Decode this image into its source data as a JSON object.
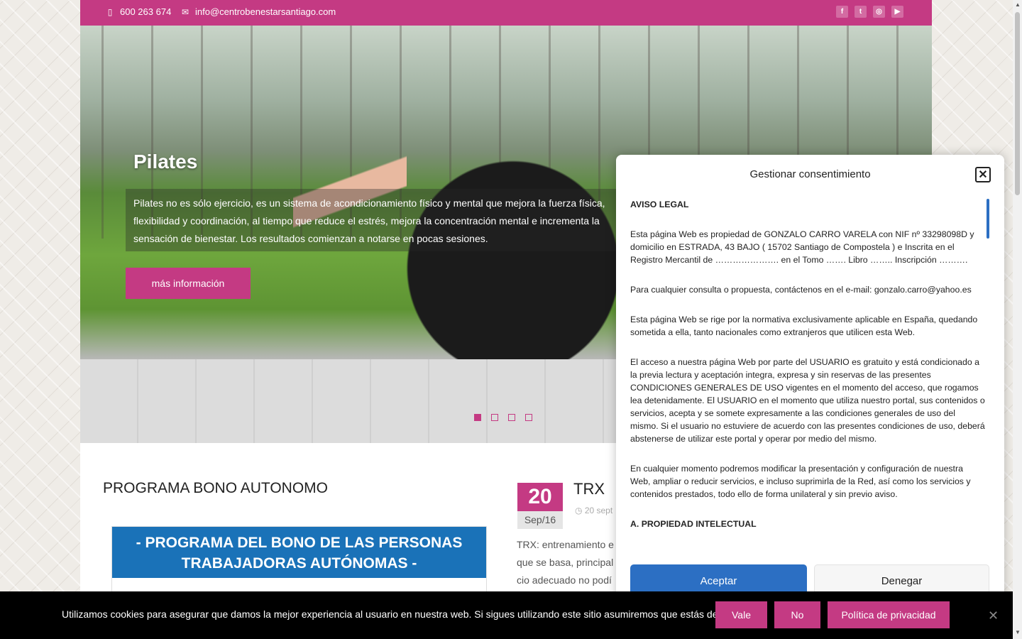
{
  "topbar": {
    "phone": "600 263 674",
    "email": "info@centrobenestarsantiago.com",
    "social": [
      "facebook-icon",
      "twitter-icon",
      "instagram-icon",
      "youtube-icon"
    ],
    "color": "#c43a83"
  },
  "hero": {
    "title": "Pilates",
    "description": "Pilates no es sólo ejercicio, es un sistema de acondicionamiento físico y mental que mejora la fuerza física, flexibilidad y coordinación, al tiempo que reduce el estrés, mejora la concentración mental e incrementa la sensación de bienestar. Los resultados comienzan a notarse en pocas sesiones.",
    "button": "más información",
    "slides": 4,
    "active_slide": 1
  },
  "left_post": {
    "title": "PROGRAMA BONO AUTONOMO",
    "image_text": "- PROGRAMA DEL BONO DE LAS PERSONAS TRABAJADORAS AUTÓNOMAS -"
  },
  "right_post": {
    "day": "20",
    "month": "Sep/16",
    "title": "TRX",
    "meta": "20 sept",
    "excerpt_lines": [
      "TRX: entrenamiento e",
      "que se basa, principal",
      "cio adecuado no podí"
    ]
  },
  "consent_modal": {
    "title": "Gestionar consentimiento",
    "heading": "AVISO LEGAL",
    "paragraphs": [
      "Esta página Web es propiedad de GONZALO CARRO VARELA con NIF nº 33298098D y domicilio en ESTRADA, 43 BAJO ( 15702 Santiago de Compostela ) e Inscrita en el Registro Mercantil de …………………. en el Tomo ……. Libro ……..  Inscripción ……….",
      "Para cualquier consulta o propuesta, contáctenos en el e-mail: gonzalo.carro@yahoo.es",
      "Esta página Web se rige por la normativa exclusivamente aplicable en España, quedando sometida a ella, tanto nacionales como extranjeros que utilicen esta Web.",
      "El acceso a nuestra página Web por parte del USUARIO es gratuito y está condicionado a la previa lectura y aceptación integra, expresa y sin reservas de las presentes CONDICIONES GENERALES DE USO vigentes en el momento del acceso, que rogamos lea detenidamente. El USUARIO en el momento que utiliza nuestro portal, sus contenidos o servicios, acepta y se somete expresamente a las condiciones generales de uso del mismo. Si el usuario no estuviere de acuerdo con las presentes condiciones de uso, deberá abstenerse de utilizar este portal y operar por medio del mismo.",
      "En cualquier momento podremos modificar la presentación y configuración de nuestra Web, ampliar o reducir servicios, e incluso suprimirla de la Red, así como los servicios y contenidos prestados, todo ello de forma unilateral y sin previo aviso."
    ],
    "subheading": "A. PROPIEDAD INTELECTUAL",
    "accept": "Aceptar",
    "deny": "Denegar",
    "accent": "#2c6fc3"
  },
  "cookie_bar": {
    "text": "Utilizamos cookies para asegurar que damos la mejor experiencia al usuario en nuestra web. Si sigues utilizando este sitio asumiremos que estás de acuerdo.",
    "vale": "Vale",
    "no": "No",
    "privacy": "Política de privacidad",
    "close": "✕"
  }
}
